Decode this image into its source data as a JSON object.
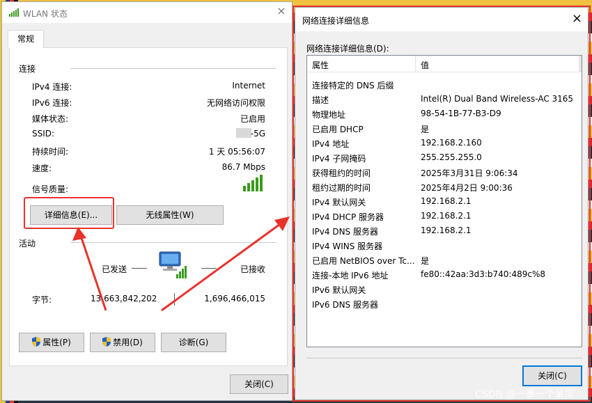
{
  "left_window": {
    "title": "WLAN 状态",
    "close": "×",
    "tab": "常规",
    "connection": {
      "section": "连接",
      "rows": [
        {
          "label": "IPv4 连接:",
          "value": "Internet"
        },
        {
          "label": "IPv6 连接:",
          "value": "无网络访问权限"
        },
        {
          "label": "媒体状态:",
          "value": "已启用"
        },
        {
          "label": "SSID:",
          "value": "-5G"
        },
        {
          "label": "持续时间:",
          "value": "1 天 05:56:07"
        },
        {
          "label": "速度:",
          "value": "86.7 Mbps"
        }
      ],
      "signal_label": "信号质量:",
      "details_button": "详细信息(E)...",
      "wireless_button": "无线属性(W)"
    },
    "activity": {
      "section": "活动",
      "sent_label": "已发送",
      "recv_label": "已接收",
      "bytes_label": "字节:",
      "sent_bytes": "13,663,842,202",
      "recv_bytes": "1,696,466,015"
    },
    "buttons": {
      "properties": "属性(P)",
      "disable": "禁用(D)",
      "diagnose": "诊断(G)",
      "close": "关闭(C)"
    }
  },
  "right_window": {
    "title": "网络连接详细信息",
    "close": "×",
    "list_label": "网络连接详细信息(D):",
    "headers": {
      "property": "属性",
      "value": "值"
    },
    "rows": [
      {
        "property": "连接特定的 DNS 后缀",
        "value": ""
      },
      {
        "property": "描述",
        "value": "Intel(R) Dual Band Wireless-AC 3165"
      },
      {
        "property": "物理地址",
        "value": "98-54-1B-77-B3-D9"
      },
      {
        "property": "已启用 DHCP",
        "value": "是"
      },
      {
        "property": "IPv4 地址",
        "value": "192.168.2.160"
      },
      {
        "property": "IPv4 子网掩码",
        "value": "255.255.255.0"
      },
      {
        "property": "获得租约的时间",
        "value": "2025年3月31日 9:06:34"
      },
      {
        "property": "租约过期的时间",
        "value": "2025年4月2日 9:00:36"
      },
      {
        "property": "IPv4 默认网关",
        "value": "192.168.2.1"
      },
      {
        "property": "IPv4 DHCP 服务器",
        "value": "192.168.2.1"
      },
      {
        "property": "IPv4 DNS 服务器",
        "value": "192.168.2.1"
      },
      {
        "property": "IPv4 WINS 服务器",
        "value": ""
      },
      {
        "property": "已启用 NetBIOS over Tc...",
        "value": "是"
      },
      {
        "property": "连接-本地 IPv6 地址",
        "value": "fe80::42aa:3d3:b740:489c%8"
      },
      {
        "property": "IPv6 默认网关",
        "value": ""
      },
      {
        "property": "IPv6 DNS 服务器",
        "value": ""
      }
    ],
    "close_button": "关闭(C)"
  },
  "watermark": "CSDN @一拳一个呆瓜",
  "colors": {
    "annotation_red": "#e8322b",
    "button_gray": "#e1e1e1",
    "focus_blue": "#0078d7",
    "signal_green": "#3a9a1c"
  }
}
